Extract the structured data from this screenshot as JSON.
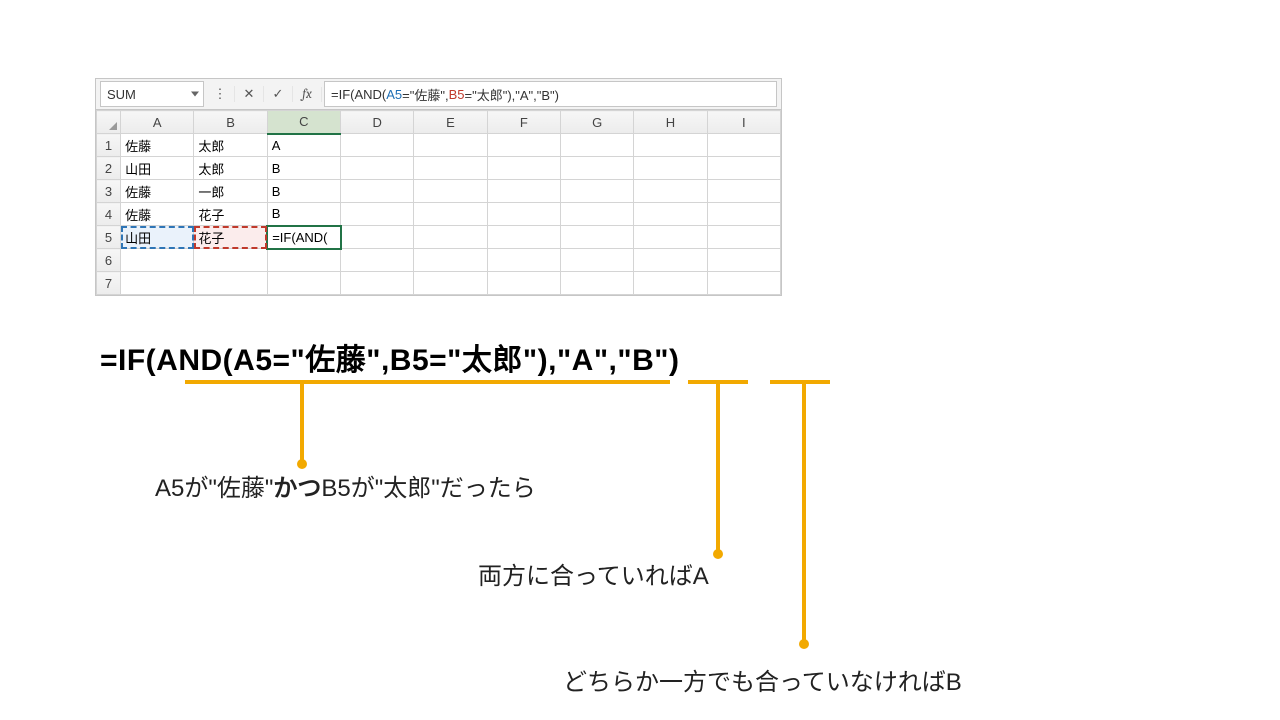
{
  "fbar": {
    "namebox": "SUM",
    "formula_plain": "=IF(AND(A5=\"佐藤\",B5=\"太郎\"),\"A\",\"B\")",
    "f_p1": "=IF(AND(",
    "f_ref1": "A5",
    "f_p2": "=\"佐藤\",",
    "f_ref2": "B5",
    "f_p3": "=\"太郎\"),\"A\",\"B\")"
  },
  "cols": [
    "A",
    "B",
    "C",
    "D",
    "E",
    "F",
    "G",
    "H",
    "I"
  ],
  "rows": {
    "1": {
      "A": "佐藤",
      "B": "太郎",
      "C": "A"
    },
    "2": {
      "A": "山田",
      "B": "太郎",
      "C": "B"
    },
    "3": {
      "A": "佐藤",
      "B": "一郎",
      "C": "B"
    },
    "4": {
      "A": "佐藤",
      "B": "花子",
      "C": "B"
    },
    "5": {
      "A": "山田",
      "B": "花子",
      "C": "=IF(AND("
    },
    "6": {},
    "7": {}
  },
  "rowlabels": [
    "1",
    "2",
    "3",
    "4",
    "5",
    "6",
    "7"
  ],
  "big_formula": "=IF(AND(A5=\"佐藤\",B5=\"太郎\"),\"A\",\"B\")",
  "note1_a": "A5が\"佐藤\"",
  "note1_b": "かつ",
  "note1_c": "B5が\"太郎\"だったら",
  "note2": "両方に合っていればA",
  "note3": "どちらか一方でも合っていなければB"
}
